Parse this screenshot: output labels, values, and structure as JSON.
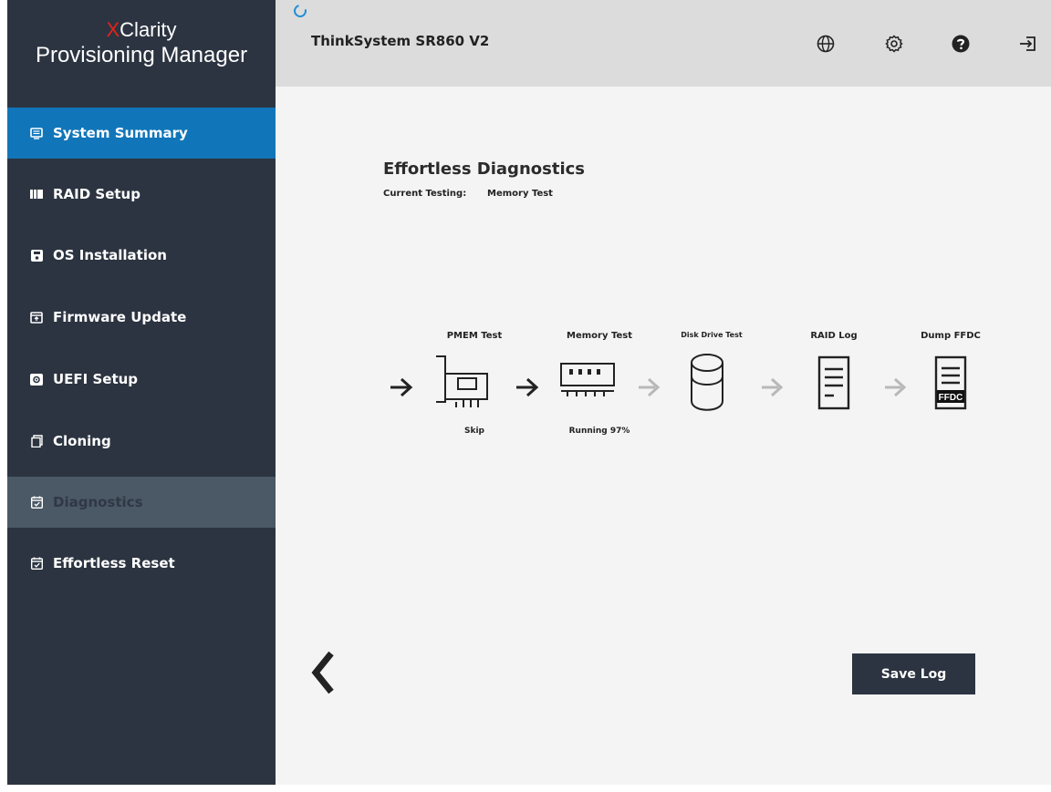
{
  "brand": {
    "line1_prefix": "X",
    "line1_rest": "Clarity",
    "line2": "Provisioning Manager"
  },
  "header": {
    "title": "ThinkSystem SR860 V2",
    "icons": [
      "globe-icon",
      "settings-icon",
      "help-icon",
      "logout-icon"
    ]
  },
  "sidebar": {
    "items": [
      {
        "label": "System Summary",
        "icon": "monitor-icon",
        "state": "active"
      },
      {
        "label": "RAID Setup",
        "icon": "raid-icon",
        "state": "normal"
      },
      {
        "label": "OS Installation",
        "icon": "disk-icon",
        "state": "normal"
      },
      {
        "label": "Firmware Update",
        "icon": "firmware-icon",
        "state": "normal"
      },
      {
        "label": "UEFI Setup",
        "icon": "uefi-icon",
        "state": "normal"
      },
      {
        "label": "Cloning",
        "icon": "clone-icon",
        "state": "normal"
      },
      {
        "label": "Diagnostics",
        "icon": "calendar-check-icon",
        "state": "selected"
      },
      {
        "label": "Effortless Reset",
        "icon": "calendar-check-icon",
        "state": "normal"
      }
    ]
  },
  "main": {
    "title": "Effortless Diagnostics",
    "current_testing_label": "Current Testing:",
    "current_testing_value": "Memory Test",
    "steps": [
      {
        "label": "PMEM Test",
        "status": "Skip",
        "icon": "pmem-card-icon",
        "state": "done"
      },
      {
        "label": "Memory Test",
        "status": "Running 97%",
        "icon": "memory-module-icon",
        "state": "running"
      },
      {
        "label": "Disk Drive Test",
        "status": "",
        "icon": "disk-drive-icon",
        "state": "pending"
      },
      {
        "label": "RAID Log",
        "status": "",
        "icon": "document-icon",
        "state": "pending"
      },
      {
        "label": "Dump FFDC",
        "status": "",
        "icon": "ffdc-document-icon",
        "state": "pending"
      }
    ],
    "ffdc_badge": "FFDC",
    "save_button": "Save Log"
  },
  "colors": {
    "sidebar_bg": "#2c3441",
    "active_nav": "#1176b9",
    "selected_nav": "#4b5865",
    "header_bg": "#dcdcdc",
    "main_bg": "#f4f4f4",
    "brand_x": "#e2231a",
    "pending_arrow": "#b8b8b8"
  }
}
